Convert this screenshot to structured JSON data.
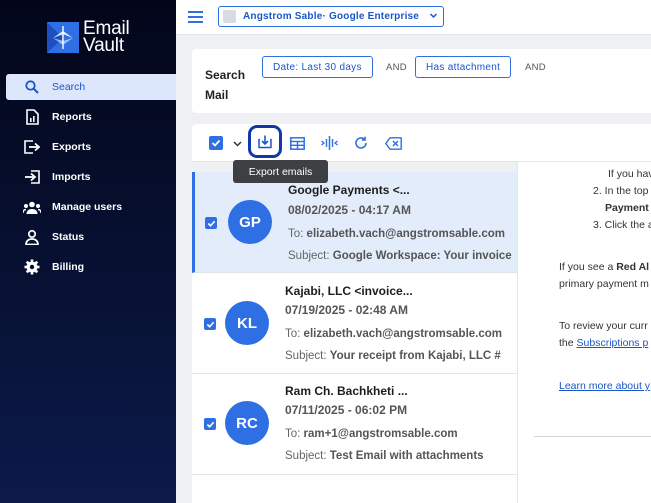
{
  "sidebar": {
    "logo_line1": "Email",
    "logo_line2": "Vault",
    "items": [
      {
        "label": "Search",
        "icon": "search-icon"
      },
      {
        "label": "Reports",
        "icon": "report-icon"
      },
      {
        "label": "Exports",
        "icon": "export-icon"
      },
      {
        "label": "Imports",
        "icon": "import-icon"
      },
      {
        "label": "Manage users",
        "icon": "users-icon"
      },
      {
        "label": "Status",
        "icon": "person-icon"
      },
      {
        "label": "Billing",
        "icon": "gear-icon"
      }
    ]
  },
  "topbar": {
    "account": "Angstrom Sable· Google Enterprise"
  },
  "search": {
    "label": "Search Mail",
    "chip1": "Date: Last 30 days",
    "and1": "AND",
    "chip2": "Has attachment",
    "and2": "AND"
  },
  "toolbar": {
    "tooltip": "Export emails"
  },
  "emails": [
    {
      "initials": "GP",
      "from": "Google Payments <...",
      "date": "08/02/2025 - 04:17 AM",
      "to_label": "To:",
      "to": "elizabeth.vach@angstromsable.com",
      "subject_label": "Subject:",
      "subject": "Google Workspace: Your invoice"
    },
    {
      "initials": "KL",
      "from": "Kajabi, LLC <invoice...",
      "date": "07/19/2025 - 02:48 AM",
      "to_label": "To:",
      "to": "elizabeth.vach@angstromsable.com",
      "subject_label": "Subject:",
      "subject": "Your receipt from Kajabi, LLC #"
    },
    {
      "initials": "RC",
      "from": "Ram Ch. Bachkheti ...",
      "date": "07/11/2025 - 06:02 PM",
      "to_label": "To:",
      "to": "ram+1@angstromsable.com",
      "subject_label": "Subject:",
      "subject": "Test Email with attachments"
    }
  ],
  "preview": {
    "l1": "If you hav",
    "l2": "2. In the top",
    "l3": "Payment",
    "l4": "3. Click the a",
    "l5a": "If you see a ",
    "l5b": "Red Al",
    "l6": "primary payment m",
    "l7": "To review your curr",
    "l8a": "the ",
    "l8b": "Subscriptions p",
    "l9": "Learn more about y"
  },
  "colors": {
    "accent": "#2f6fe4",
    "sidebar": "#071133"
  }
}
